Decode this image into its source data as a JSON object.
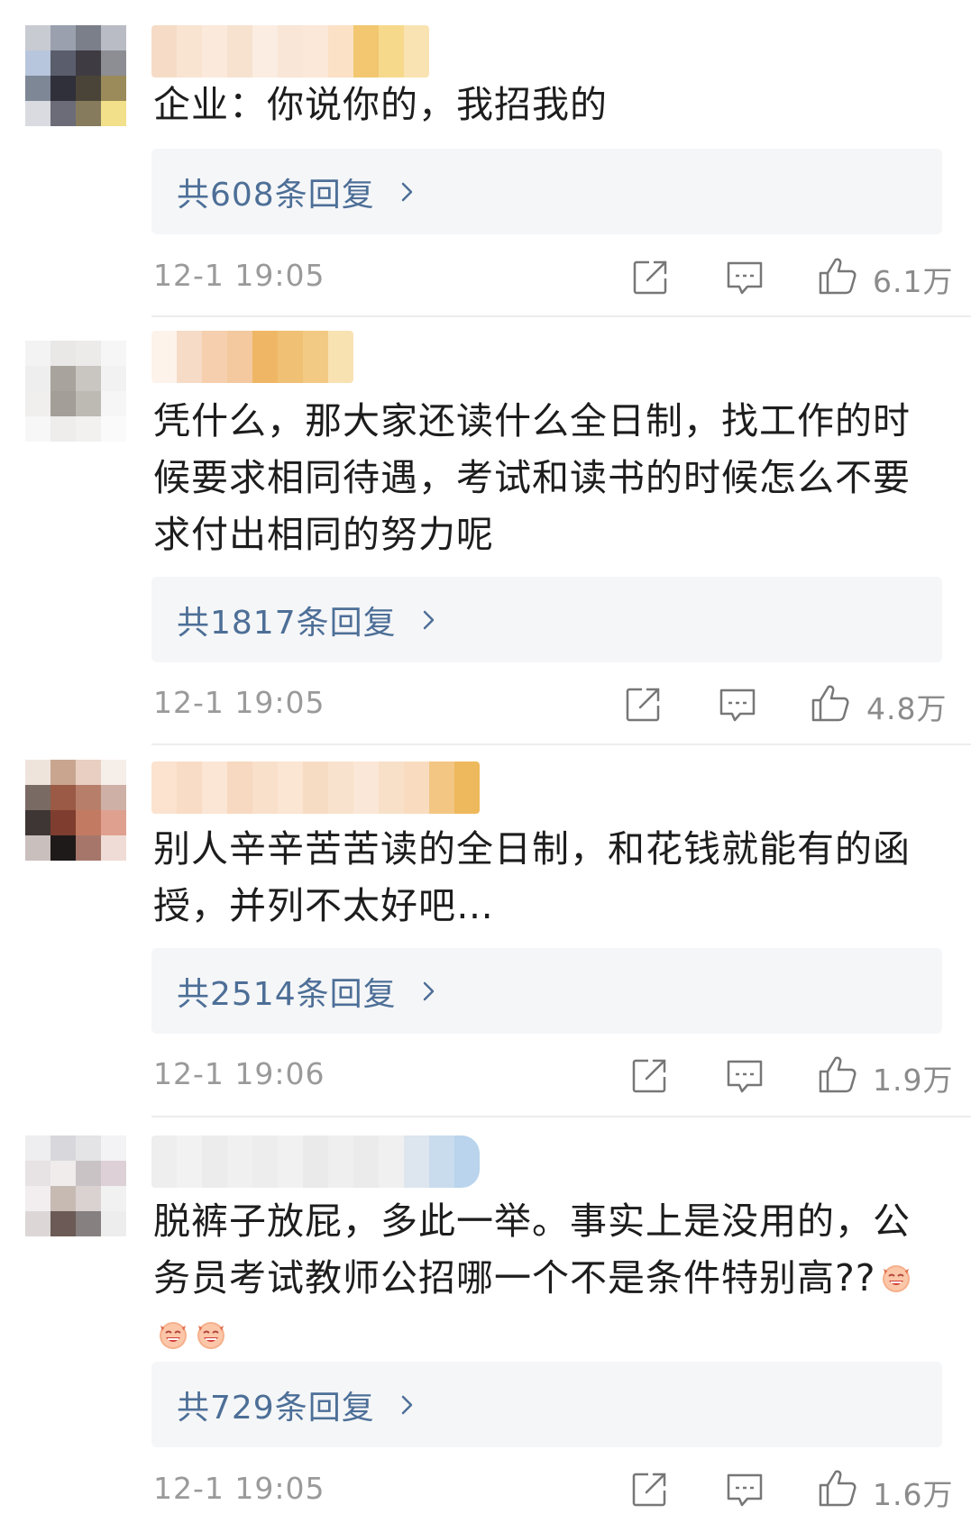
{
  "comments": [
    {
      "text": "企业：你说你的，我招我的",
      "reply_label": "共608条回复",
      "time": "12-1 19:05",
      "likes": "6.1万"
    },
    {
      "text": "凭什么，那大家还读什么全日制，找工作的时候要求相同待遇，考试和读书的时候怎么不要求付出相同的努力呢",
      "reply_label": "共1817条回复",
      "time": "12-1 19:05",
      "likes": "4.8万"
    },
    {
      "text": "别人辛辛苦苦读的全日制，和花钱就能有的函授，并列不太好吧…",
      "reply_label": "共2514条回复",
      "time": "12-1 19:06",
      "likes": "1.9万"
    },
    {
      "text": "脱裤子放屁，多此一举。事实上是没用的，公务员考试教师公招哪一个不是条件特别高??",
      "reply_label": "共729条回复",
      "time": "12-1 19:05",
      "likes": "1.6万"
    }
  ],
  "icons": {
    "share": "share-icon",
    "comment": "comment-icon",
    "like": "thumbs-up-icon",
    "chevron": "chevron-right-icon",
    "emoji": "laughing-emoji-icon"
  },
  "colors": {
    "reply_link": "#4d6f97",
    "reply_bg": "#f5f6f8",
    "meta": "#9a9a9a"
  }
}
